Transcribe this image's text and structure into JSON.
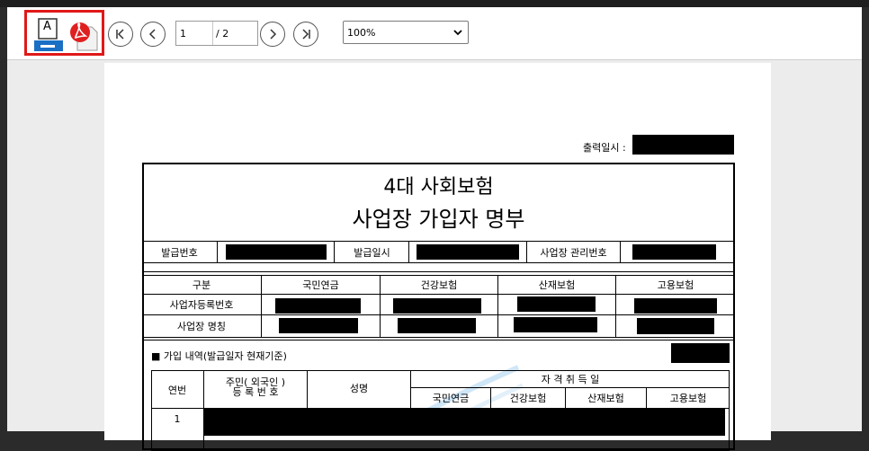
{
  "toolbar": {
    "print_icon_label": "A",
    "current_page": "1",
    "total_pages": "/ 2",
    "zoom": "100%"
  },
  "document": {
    "print_datetime_label": "출력일시 :",
    "title_line1": "4대 사회보험",
    "title_line2": "사업장 가입자 명부",
    "issue_no_label": "발급번호",
    "issue_date_label": "발급일시",
    "mgmt_no_label": "사업장 관리번호",
    "table1": {
      "headers": [
        "구분",
        "국민연금",
        "건강보험",
        "산재보험",
        "고용보험"
      ],
      "row_labels": [
        "사업자등록번호",
        "사업장 명칭"
      ]
    },
    "section_title": "■ 가입 내역(발급일자 현재기준)",
    "table2": {
      "col_seq": "연번",
      "col_id_line1": "주민( 외국인 )",
      "col_id_line2": "등 록 번 호",
      "col_name": "성명",
      "col_qual": "자 격 취 득 일",
      "sub_cols": [
        "국민연금",
        "건강보험",
        "산재보험",
        "고용보험"
      ],
      "first_row_seq": "1"
    }
  },
  "colors": {
    "highlight": "#e01818",
    "print_icon": "#1a6fc4",
    "pdf_icon": "#e02020"
  }
}
